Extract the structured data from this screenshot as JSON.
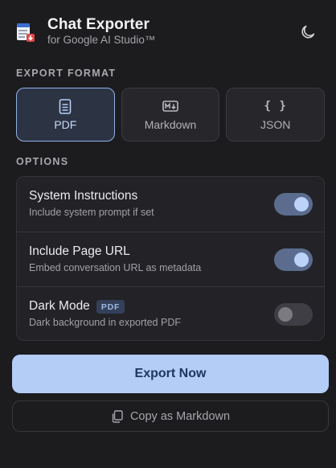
{
  "header": {
    "title": "Chat Exporter",
    "subtitle": "for Google AI Studio™",
    "icons": {
      "app": "document-export-icon",
      "theme": "moon-icon"
    }
  },
  "export_format": {
    "label": "EXPORT FORMAT",
    "selected": "PDF",
    "options": [
      {
        "label": "PDF",
        "icon": "document-icon",
        "active": true
      },
      {
        "label": "Markdown",
        "icon": "markdown-icon",
        "active": false
      },
      {
        "label": "JSON",
        "icon": "json-braces-icon",
        "active": false
      }
    ]
  },
  "options": {
    "label": "OPTIONS",
    "items": [
      {
        "title": "System Instructions",
        "description": "Include system prompt if set",
        "enabled": true
      },
      {
        "title": "Include Page URL",
        "description": "Embed conversation URL as metadata",
        "enabled": true
      },
      {
        "title": "Dark Mode",
        "badge": "PDF",
        "description": "Dark background in exported PDF",
        "enabled": false
      }
    ]
  },
  "actions": {
    "primary_label": "Export Now",
    "secondary_label": "Copy as Markdown",
    "secondary_icon": "copy-icon"
  },
  "colors": {
    "background": "#1c1c1f",
    "accent": "#b3cdf6",
    "accent_text": "#1e3660",
    "toggle_on": "#5b6c8f"
  }
}
